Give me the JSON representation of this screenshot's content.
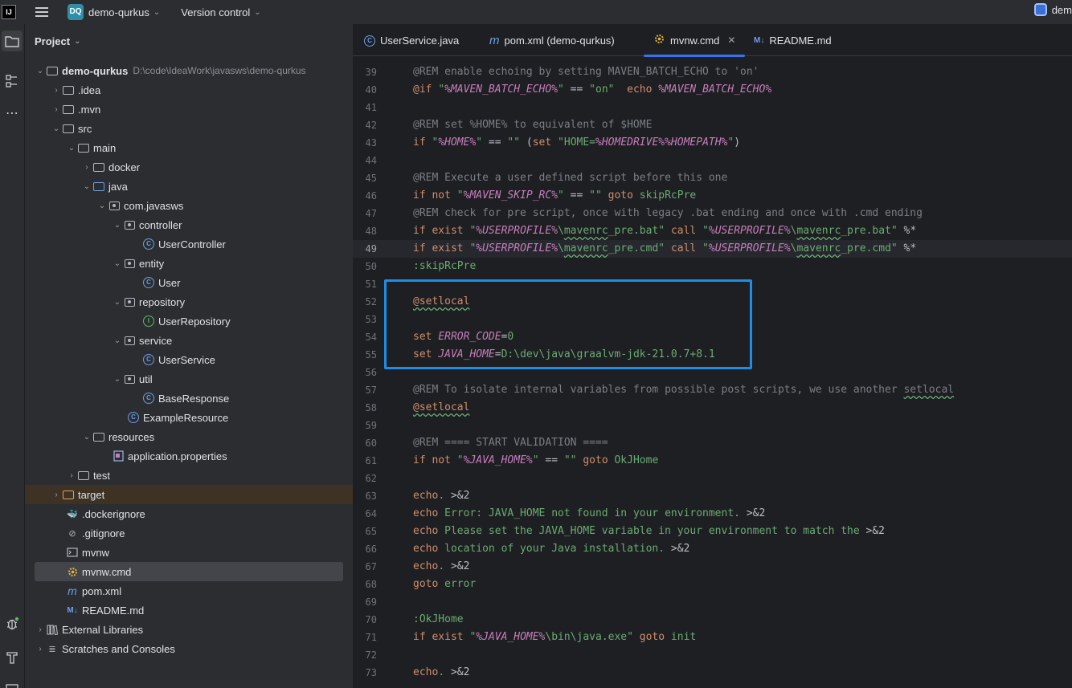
{
  "titlebar": {
    "logo": "IJ",
    "project_badge": "DQ",
    "project_name": "demo-qurkus",
    "version_control": "Version control",
    "right_label": "dem"
  },
  "project_panel": {
    "title": "Project",
    "root_name": "demo-qurkus",
    "root_path": "D:\\code\\IdeaWork\\javasws\\demo-qurkus",
    "items": [
      {
        "label": ".idea"
      },
      {
        "label": ".mvn"
      },
      {
        "label": "src"
      },
      {
        "label": "main"
      },
      {
        "label": "docker"
      },
      {
        "label": "java"
      },
      {
        "label": "com.javasws"
      },
      {
        "label": "controller"
      },
      {
        "label": "UserController"
      },
      {
        "label": "entity"
      },
      {
        "label": "User"
      },
      {
        "label": "repository"
      },
      {
        "label": "UserRepository"
      },
      {
        "label": "service"
      },
      {
        "label": "UserService"
      },
      {
        "label": "util"
      },
      {
        "label": "BaseResponse"
      },
      {
        "label": "ExampleResource"
      },
      {
        "label": "resources"
      },
      {
        "label": "application.properties"
      },
      {
        "label": "test"
      },
      {
        "label": "target"
      },
      {
        "label": ".dockerignore"
      },
      {
        "label": ".gitignore"
      },
      {
        "label": "mvnw"
      },
      {
        "label": "mvnw.cmd"
      },
      {
        "label": "pom.xml"
      },
      {
        "label": "README.md"
      },
      {
        "label": "External Libraries"
      },
      {
        "label": "Scratches and Consoles"
      }
    ]
  },
  "tabs": [
    {
      "label": "UserService.java"
    },
    {
      "label": "pom.xml (demo-qurkus)"
    },
    {
      "label": "mvnw.cmd"
    },
    {
      "label": "README.md"
    }
  ],
  "code": {
    "line_numbers": [
      "39",
      "40",
      "41",
      "42",
      "43",
      "44",
      "45",
      "46",
      "47",
      "48",
      "49",
      "50",
      "51",
      "52",
      "53",
      "54",
      "55",
      "56",
      "57",
      "58",
      "59",
      "60",
      "61",
      "62",
      "63",
      "64",
      "65",
      "66",
      "67",
      "68",
      "69",
      "70",
      "71",
      "72",
      "73"
    ]
  }
}
